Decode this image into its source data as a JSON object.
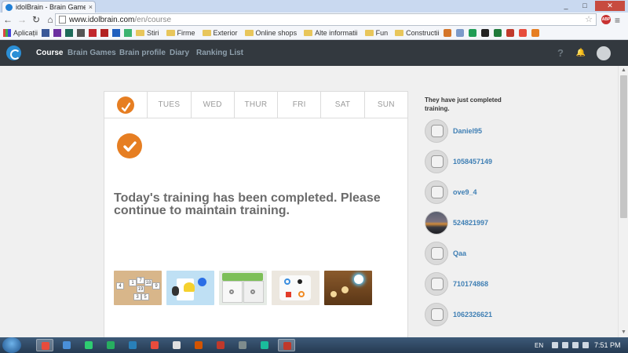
{
  "browser": {
    "tab_title": "idolBrain - Brain Games &",
    "tab_close": "×",
    "url_host": "www.idolbrain.com",
    "url_path": "/en/course",
    "star": "☆",
    "abp_label": "ABP",
    "menu": "≡",
    "minimize": "_",
    "maximize": "□",
    "close": "✕",
    "back": "←",
    "forward": "→",
    "reload": "↻",
    "home": "⌂"
  },
  "bookmarks": {
    "apps_label": "Aplicații",
    "folders": [
      "Stiri",
      "Firme",
      "Exterior",
      "Online shops",
      "Alte informatii",
      "Fun",
      "Constructii"
    ],
    "leading_icon_colors": [
      "#3b5998",
      "#6b2fa0",
      "#1d6b5a",
      "#555555",
      "#c1272d",
      "#b22222",
      "#1f5fbf",
      "#3cb371"
    ],
    "trailing_icon_colors": [
      "#d4762a",
      "#7b9ac9",
      "#1f9d55",
      "#222222",
      "#1f7a3a",
      "#c0392b",
      "#e74c3c",
      "#e67e22"
    ]
  },
  "appnav": {
    "links": [
      {
        "label": "Course",
        "active": true
      },
      {
        "label": "Brain Games",
        "active": false
      },
      {
        "label": "Brain profile",
        "active": false
      },
      {
        "label": "Diary",
        "active": false
      },
      {
        "label": "Ranking List",
        "active": false
      }
    ],
    "help_icon": "?",
    "bell_icon": "🔔"
  },
  "course": {
    "days": [
      "TUES",
      "WED",
      "THUR",
      "FRI",
      "SAT",
      "SUN"
    ],
    "message": "Today's training has been completed. Please continue to maintain training.",
    "flame_color": "#e67e22"
  },
  "games": [
    {
      "name": "number-tiles",
      "numbers": [
        "4",
        "1",
        "7",
        "18",
        "9",
        "19",
        "3",
        "5"
      ]
    },
    {
      "name": "card-shapes"
    },
    {
      "name": "dice-blocks"
    },
    {
      "name": "symbol-board"
    },
    {
      "name": "light-orbs"
    }
  ],
  "sidebar": {
    "title": "They have just completed training.",
    "users": [
      {
        "name": "Daniel95",
        "photo": false
      },
      {
        "name": "1058457149",
        "photo": false
      },
      {
        "name": "ove9_4",
        "photo": false
      },
      {
        "name": "524821997",
        "photo": true
      },
      {
        "name": "Qaa",
        "photo": false
      },
      {
        "name": "710174868",
        "photo": false
      },
      {
        "name": "1062326621",
        "photo": false
      }
    ]
  },
  "scrollbar": {
    "up": "▲",
    "down": "▼"
  },
  "taskbar": {
    "lang": "EN",
    "clock": "7:51 PM",
    "apps": [
      {
        "color": "#e74c3c",
        "active": true
      },
      {
        "color": "#4a90d9",
        "active": false
      },
      {
        "color": "#2ecc71",
        "active": false
      },
      {
        "color": "#27ae60",
        "active": false
      },
      {
        "color": "#2980b9",
        "active": false
      },
      {
        "color": "#e84c3d",
        "active": false
      },
      {
        "color": "#e0e0e0",
        "active": false
      },
      {
        "color": "#d35400",
        "active": false
      },
      {
        "color": "#c0392b",
        "active": false
      },
      {
        "color": "#7f8c8d",
        "active": false
      },
      {
        "color": "#1abc9c",
        "active": false
      },
      {
        "color": "#c0392b",
        "active": true
      }
    ]
  }
}
